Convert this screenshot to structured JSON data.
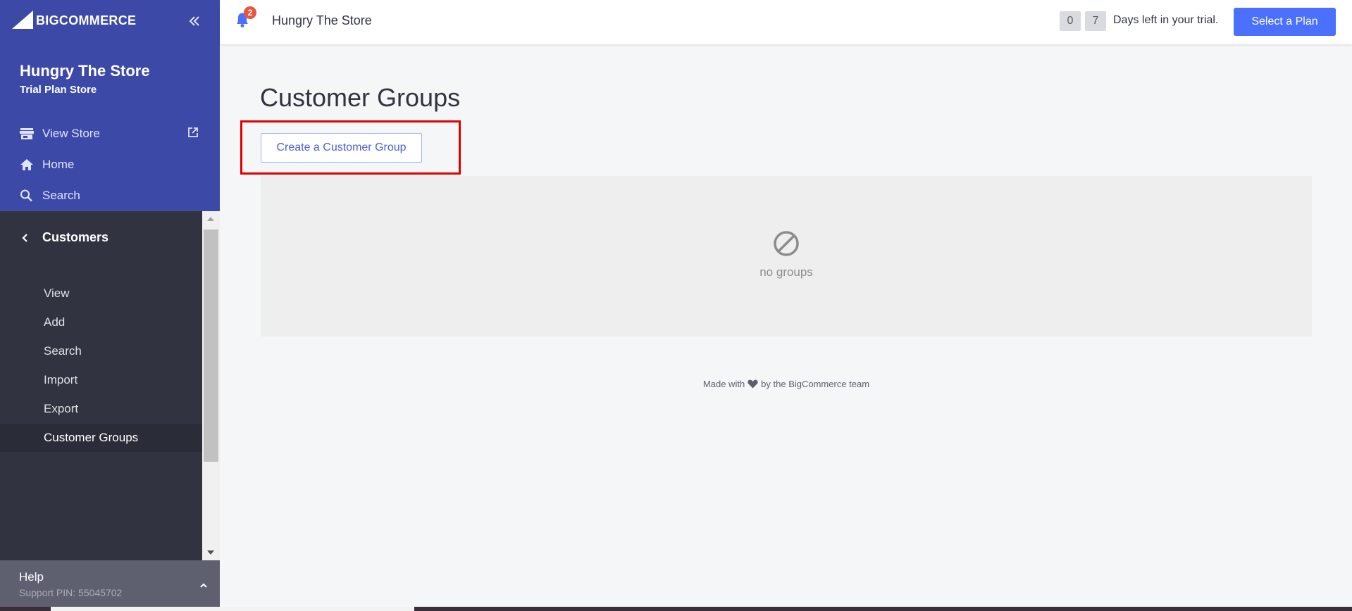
{
  "sidebar": {
    "logo_text": "BIGCOMMERCE",
    "store_name": "Hungry The Store",
    "store_plan": "Trial Plan Store",
    "top_nav": [
      {
        "label": "View Store",
        "icon": "store-icon"
      },
      {
        "label": "Home",
        "icon": "home-icon"
      },
      {
        "label": "Search",
        "icon": "search-icon"
      }
    ],
    "section_title": "Customers",
    "sub_items": [
      {
        "label": "View"
      },
      {
        "label": "Add"
      },
      {
        "label": "Search"
      },
      {
        "label": "Import"
      },
      {
        "label": "Export"
      },
      {
        "label": "Customer Groups",
        "active": true
      }
    ],
    "help": {
      "title": "Help",
      "pin": "Support PIN: 55045702"
    }
  },
  "topbar": {
    "notification_count": "2",
    "store_name": "Hungry The Store",
    "days_digits": [
      "0",
      "7"
    ],
    "trial_text": "Days left in your trial.",
    "plan_button": "Select a Plan"
  },
  "main": {
    "title": "Customer Groups",
    "create_button": "Create a Customer Group",
    "empty_text": "no groups",
    "footer_before": "Made with",
    "footer_after": "by the BigCommerce team"
  },
  "colors": {
    "sidebar_top": "#3c49a7",
    "sidebar_sub": "#313440",
    "accent": "#4b71fc",
    "badge": "#e8553f",
    "highlight": "#e00000"
  }
}
